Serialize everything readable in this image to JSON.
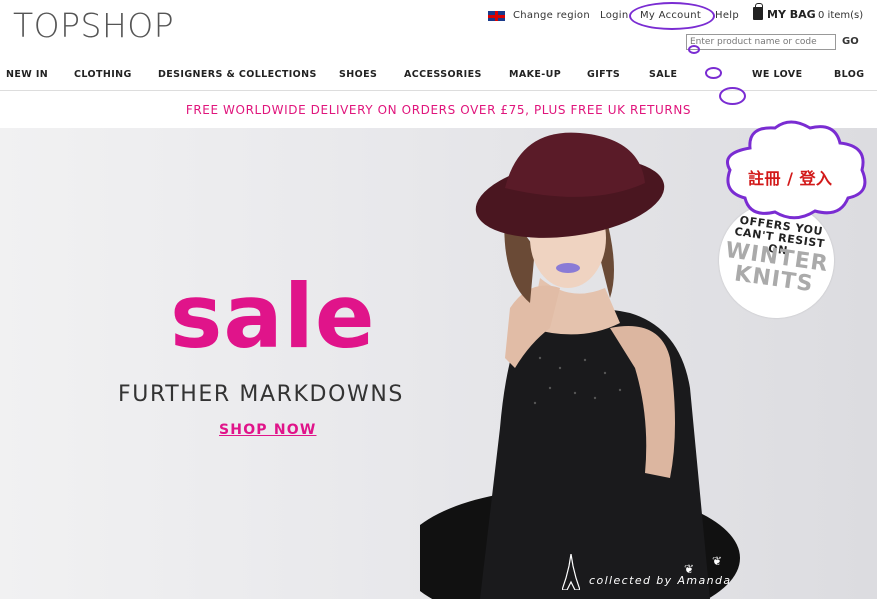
{
  "header": {
    "logo": "TOPSHOP",
    "change_region": "Change region",
    "login": "Login",
    "my_account": "My Account",
    "help": "Help",
    "bag_label": "MY BAG",
    "bag_count": "0 item(s)",
    "search_placeholder": "Enter product name or code",
    "go_label": "GO"
  },
  "nav": {
    "items": [
      {
        "label": "NEW IN"
      },
      {
        "label": "CLOTHING"
      },
      {
        "label": "DESIGNERS & COLLECTIONS"
      },
      {
        "label": "SHOES"
      },
      {
        "label": "ACCESSORIES"
      },
      {
        "label": "MAKE-UP"
      },
      {
        "label": "GIFTS"
      },
      {
        "label": "SALE"
      },
      {
        "label": "WE LOVE"
      },
      {
        "label": "BLOG"
      }
    ]
  },
  "promo": {
    "text": "FREE WORLDWIDE DELIVERY ON ORDERS OVER £75, PLUS FREE UK RETURNS"
  },
  "hero": {
    "headline": "sale",
    "subhead": "FURTHER MARKDOWNS",
    "cta": "SHOP NOW",
    "badge_line1": "OFFERS YOU\nCAN'T RESIST ON",
    "badge_line2": "WINTER\nKNITS"
  },
  "annotation": {
    "callout": "註冊 / 登入",
    "watermark": "collected by Amanda"
  },
  "colors": {
    "brand_pink": "#e0148a",
    "annotation_purple": "#7a2cd2",
    "annotation_red": "#d21919"
  }
}
